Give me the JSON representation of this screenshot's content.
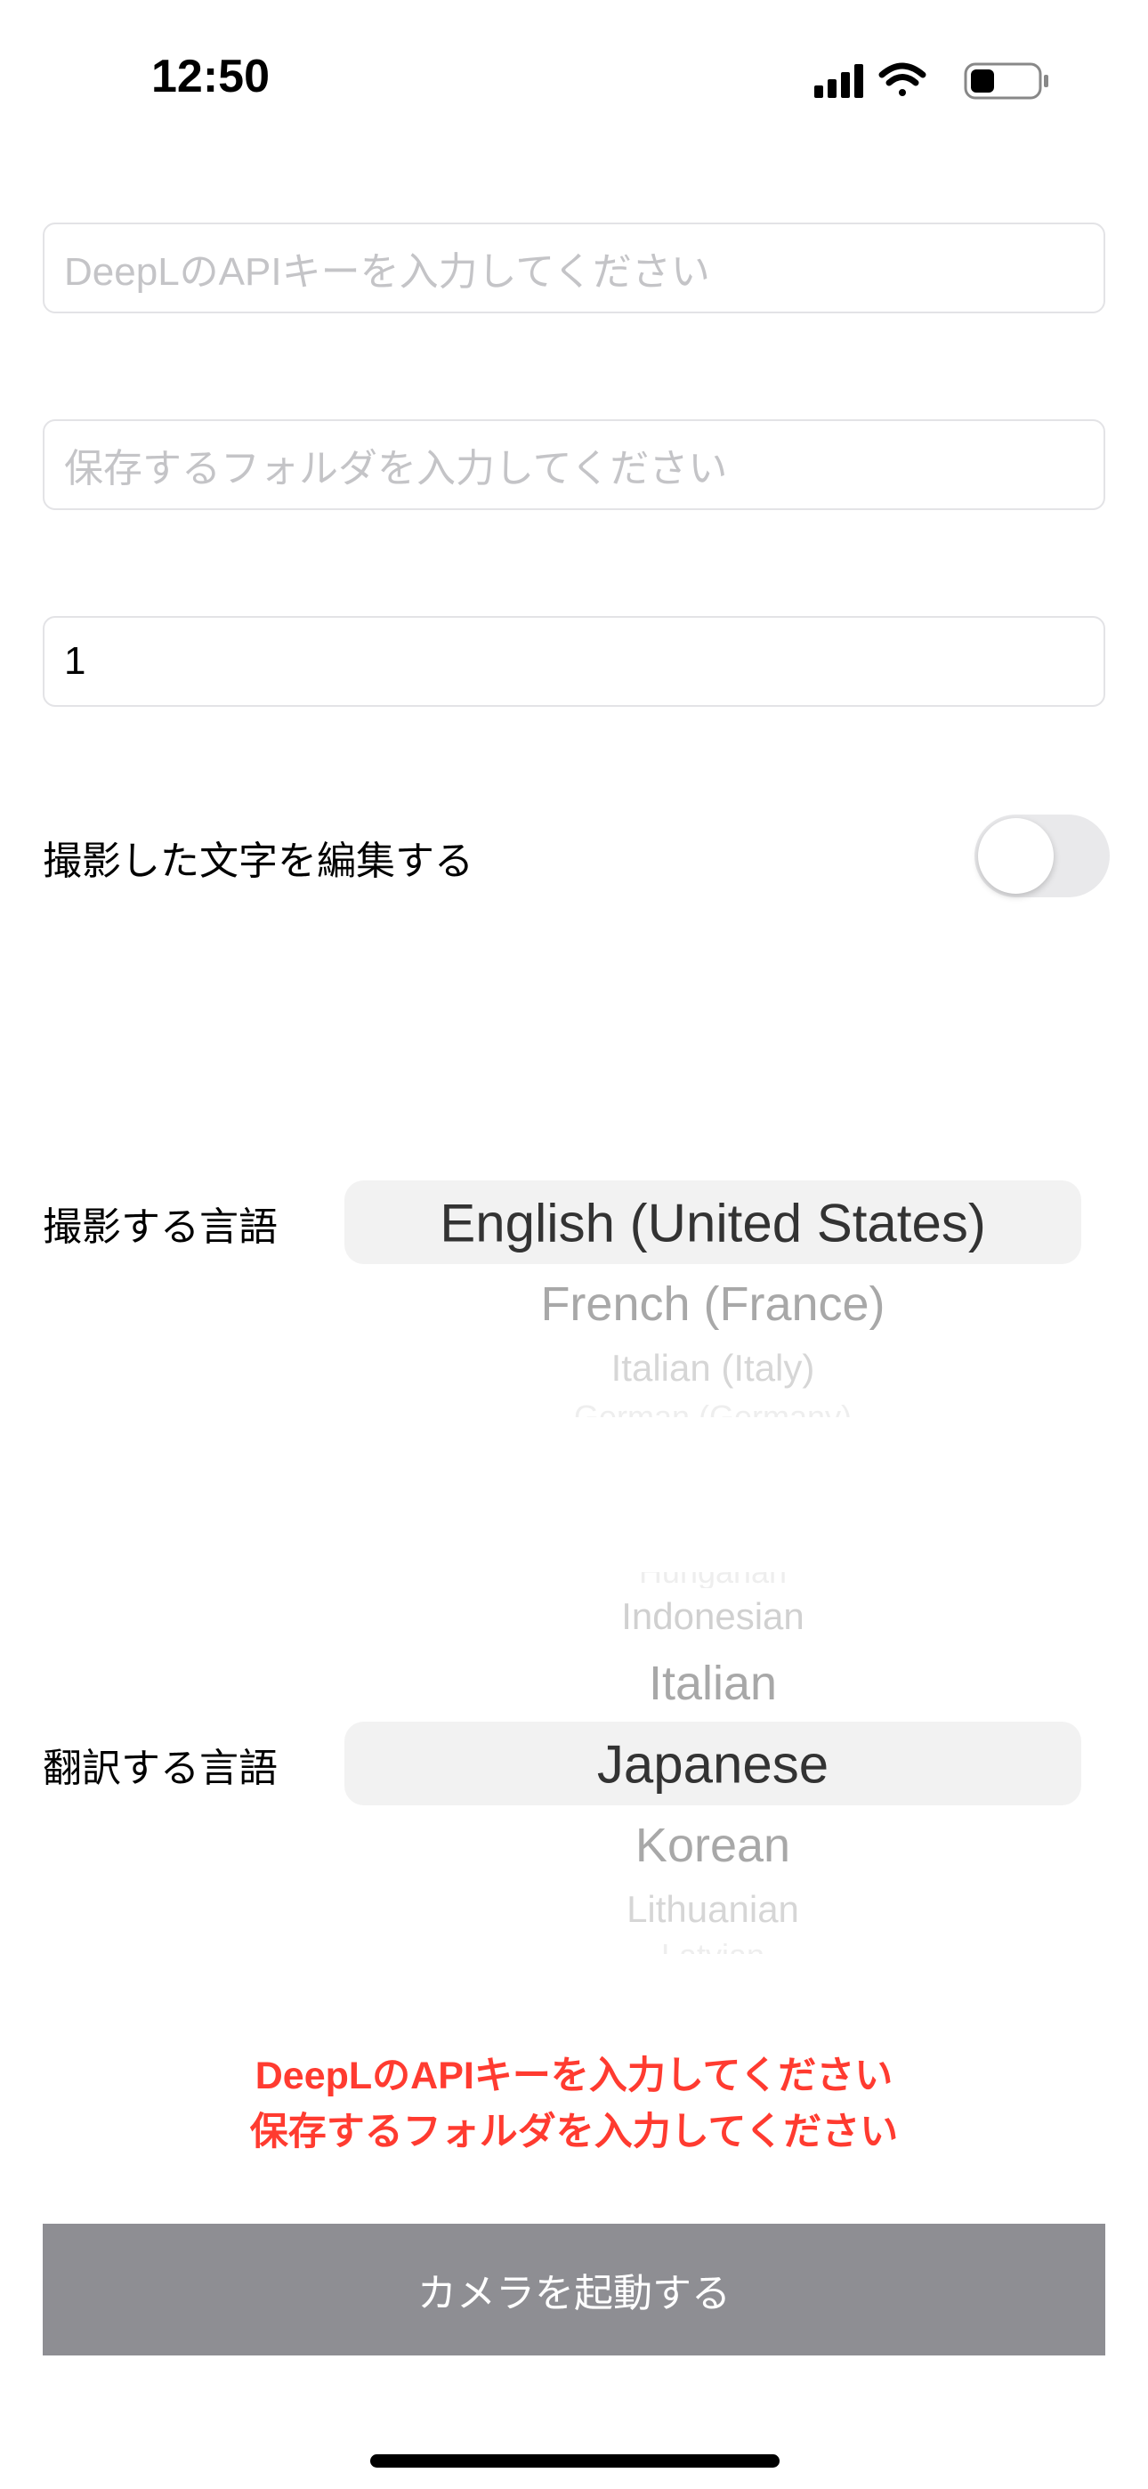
{
  "status_bar": {
    "time": "12:50",
    "icons": [
      "cellular-signal-icon",
      "wifi-icon",
      "battery-low-icon"
    ]
  },
  "fields": {
    "api_key": {
      "value": "",
      "placeholder": "DeepLのAPIキーを入力してください"
    },
    "folder": {
      "value": "",
      "placeholder": "保存するフォルダを入力してください"
    },
    "number": {
      "value": "1"
    }
  },
  "edit_toggle": {
    "label": "撮影した文字を編集する",
    "on": false
  },
  "source_picker": {
    "label": "撮影する言語",
    "selected": "English (United States)",
    "items": [
      "English (United States)",
      "French (France)",
      "Italian (Italy)",
      "German (Germany)"
    ]
  },
  "target_picker": {
    "label": "翻訳する言語",
    "selected": "Japanese",
    "items": [
      "Hungarian",
      "Indonesian",
      "Italian",
      "Japanese",
      "Korean",
      "Lithuanian",
      "Latvian"
    ]
  },
  "errors": [
    "DeepLのAPIキーを入力してください",
    "保存するフォルダを入力してください"
  ],
  "camera_button": {
    "label": "カメラを起動する"
  },
  "colors": {
    "error": "#ff3b30",
    "button_disabled": "#8e8e93",
    "picker_selection": "#f2f2f2"
  }
}
